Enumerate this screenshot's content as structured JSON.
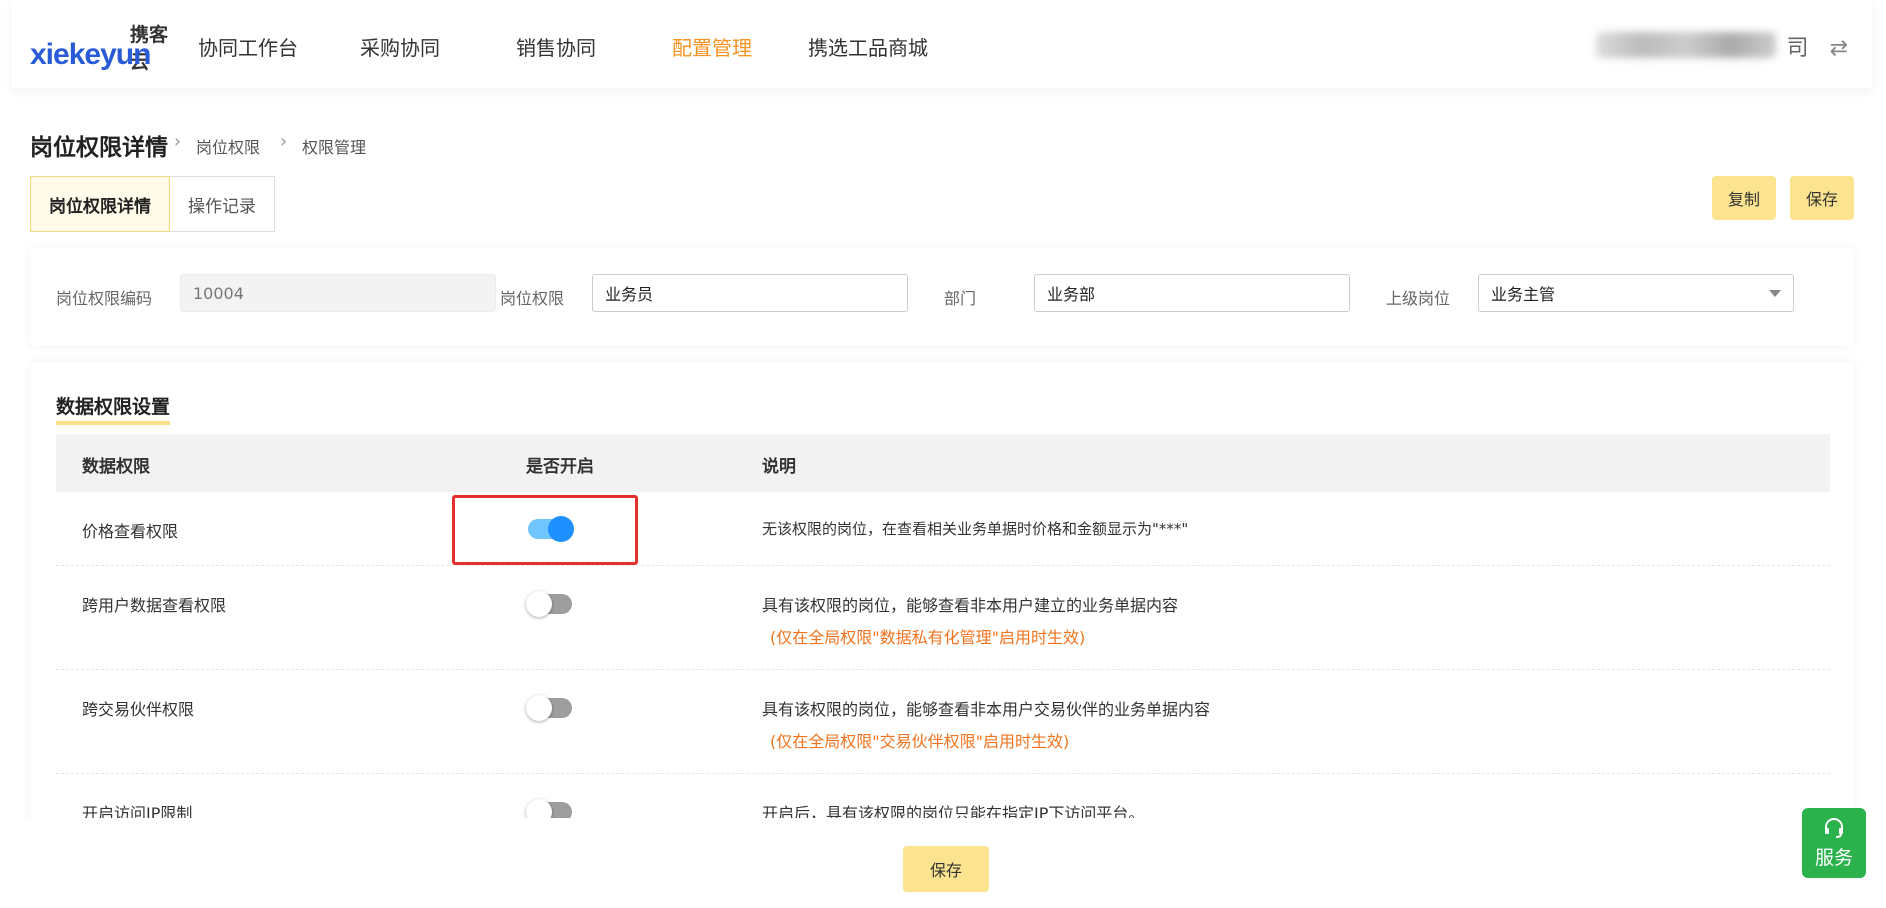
{
  "header": {
    "logo_text_zh": "携客云",
    "logo_text_en": "xiekeyun",
    "nav": [
      "协同工作台",
      "采购协同",
      "销售协同",
      "配置管理",
      "携选工品商城"
    ],
    "active_nav": "配置管理",
    "company_suffix": "司",
    "switch_icon": "⇄"
  },
  "page": {
    "title": "岗位权限详情",
    "crumb1": "岗位权限",
    "crumb2": "权限管理",
    "sep": "›"
  },
  "tabs": [
    "岗位权限详情",
    "操作记录"
  ],
  "actions": {
    "copy": "复制",
    "save": "保存"
  },
  "form": {
    "code_label": "岗位权限编码",
    "code_value": "10004",
    "role_label": "岗位权限",
    "role_value": "业务员",
    "dept_label": "部门",
    "dept_value": "业务部",
    "superior_label": "上级岗位",
    "superior_value": "业务主管"
  },
  "data_section": {
    "title": "数据权限设置",
    "headers": [
      "数据权限",
      "是否开启",
      "说明"
    ],
    "rows": [
      {
        "name": "价格查看权限",
        "enabled": true,
        "desc": "无该权限的岗位，在查看相关业务单据时价格和金额显示为\"***\"",
        "note": ""
      },
      {
        "name": "跨用户数据查看权限",
        "enabled": false,
        "desc": "具有该权限的岗位，能够查看非本用户建立的业务单据内容",
        "note": "(仅在全局权限\"数据私有化管理\"启用时生效)"
      },
      {
        "name": "跨交易伙伴权限",
        "enabled": false,
        "desc": "具有该权限的岗位，能够查看非本用户交易伙伴的业务单据内容",
        "note": "(仅在全局权限\"交易伙伴权限\"启用时生效)"
      },
      {
        "name": "开启访问IP限制",
        "enabled": false,
        "desc": "开启后，具有该权限的岗位只能在指定IP下访问平台。",
        "note": ""
      }
    ]
  },
  "footer": {
    "save": "保存"
  },
  "service": {
    "label": "服务",
    "icon": "headset-icon"
  }
}
